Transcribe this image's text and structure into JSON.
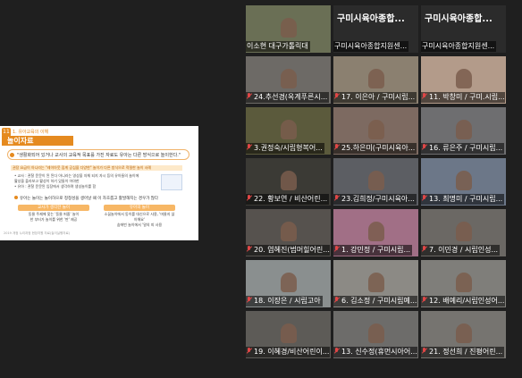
{
  "slide": {
    "number": "11",
    "breadcrumb": "1. 유아교육의 이해",
    "title": "놀이자료",
    "quote": "\"생활화되어 있거나 교사의 교육적 목표를 가진 자료도 유아는 다른 방식으로 놀이한다.\"",
    "highlight": "권장 요급이 아니라는 \"레이아웃 집게 공심을 다양한\" 놀이가 다른 방식으로 적절한 놀이 사례",
    "bullets": [
      "• 교사 : 관찰 문문이 된 된다 아니라는 영상을 자체 되지 자시 등의 유아들의 놀이에",
      "  활성을 플라보고 활성이 하기 있들이 어야한",
      "• 유아 : 관찰 문문된 입장에서 생각하며 생성놀이를 함"
    ],
    "question": "유아는 놀이는 놀이하으로 정청성을 생어날 때 이 자호롭고 활발해지는 경우가 많다",
    "box_left_head": "교사가 생각한 놀이",
    "box_left_body": "동물 주제에 맞는 '동물 퍼즐' 놀이\n한 부터가 놀이를 위한 '판' 제공",
    "box_right_head": "유아의 놀이",
    "box_right_body": "소꿉놀이에서 동이를 대신으로 사용, '머물지 않아해요'\n숨에번 놀이에서 '말의 피 사용",
    "footer": "2019 개정 누리과정 현장지원 자료(놀이실행자료)"
  },
  "participants": [
    {
      "label": "이소현 대구가톨릭대",
      "mic": false,
      "active": true,
      "video": "#6a6f55",
      "big": ""
    },
    {
      "label": "구미시육아종합지원센...",
      "mic": false,
      "active": false,
      "video": "#2b2b2b",
      "big": "구미시육아종합..."
    },
    {
      "label": "구미시육아종합지원센...",
      "mic": false,
      "active": false,
      "video": "#2b2b2b",
      "big": "구미시육아종합..."
    },
    {
      "label": "24.추선경(옥계푸른시...",
      "mic": true,
      "active": false,
      "video": "#6d6a66",
      "big": ""
    },
    {
      "label": "17. 이은아 / 구미시립...",
      "mic": true,
      "active": false,
      "video": "#8b8070",
      "big": ""
    },
    {
      "label": "11. 박창미 / 구미.시립...",
      "mic": true,
      "active": false,
      "video": "#b39b8a",
      "big": ""
    },
    {
      "label": "3.권정숙/시립형복어...",
      "mic": true,
      "active": false,
      "video": "#5b5a3c",
      "big": ""
    },
    {
      "label": "25.하은미(구미시육아...",
      "mic": true,
      "active": false,
      "video": "#7d6a61",
      "big": ""
    },
    {
      "label": "16. 류은주 / 구미시립...",
      "mic": true,
      "active": false,
      "video": "#6e6e70",
      "big": ""
    },
    {
      "label": "22. 황보연 / 비산어린...",
      "mic": true,
      "active": false,
      "video": "#3b3a35",
      "big": ""
    },
    {
      "label": "23.김희정/구미시육아...",
      "mic": true,
      "active": false,
      "video": "#5c5e63",
      "big": ""
    },
    {
      "label": "13. 최명미 / 구미시립...",
      "mic": true,
      "active": false,
      "video": "#6c7788",
      "big": ""
    },
    {
      "label": "20. 염혜진(범머힐어린...",
      "mic": true,
      "active": false,
      "video": "#56524e",
      "big": ""
    },
    {
      "label": "1. 강민정 / 구미시립...",
      "mic": true,
      "active": false,
      "video": "#a16f86",
      "big": ""
    },
    {
      "label": "7. 이민경 / 시립인성...",
      "mic": true,
      "active": false,
      "video": "#6b6864",
      "big": ""
    },
    {
      "label": "18. 이장은 / 시립고아",
      "mic": true,
      "active": false,
      "video": "#8a8f8f",
      "big": ""
    },
    {
      "label": "6. 김소정 / 구미시립예...",
      "mic": true,
      "active": false,
      "video": "#8c8a85",
      "big": ""
    },
    {
      "label": "12. 배예리/시립인성어...",
      "mic": true,
      "active": false,
      "video": "#7f7e7a",
      "big": ""
    },
    {
      "label": "19. 이혜경/비산어린이...",
      "mic": true,
      "active": false,
      "video": "#5d5b57",
      "big": ""
    },
    {
      "label": "13. 신수정(휴먼시아어...",
      "mic": true,
      "active": false,
      "video": "#6d6c6a",
      "big": ""
    },
    {
      "label": "21. 정선희 / 진평어린...",
      "mic": true,
      "active": false,
      "video": "#767470",
      "big": ""
    }
  ]
}
